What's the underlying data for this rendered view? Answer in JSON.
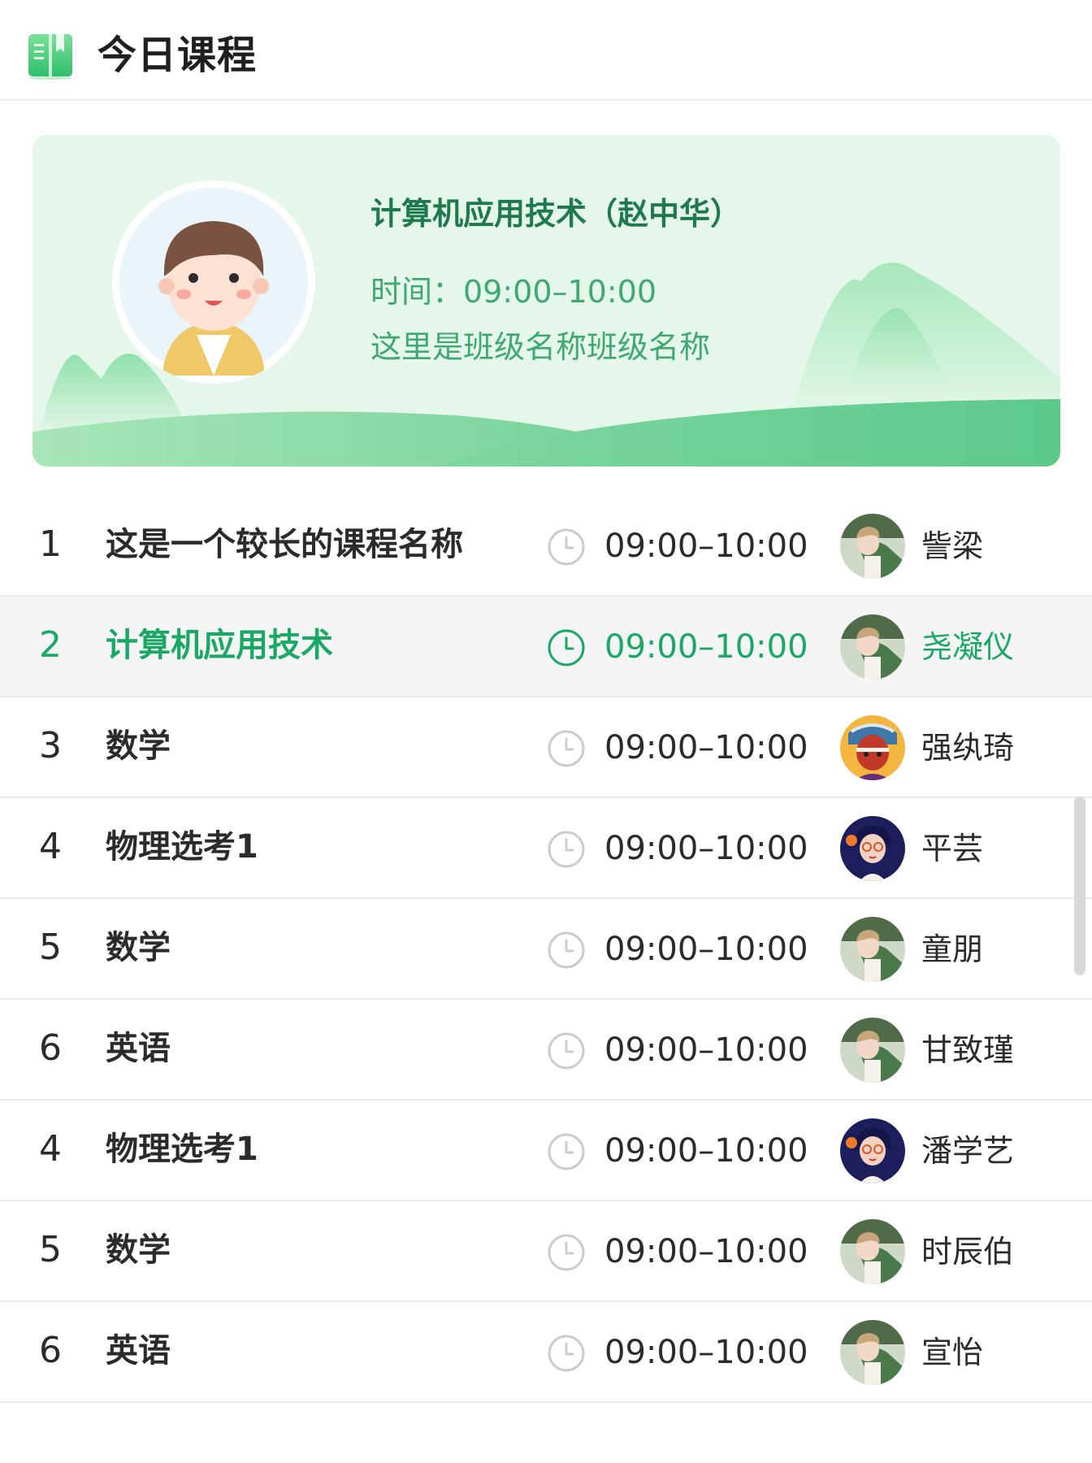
{
  "header": {
    "title": "今日课程",
    "icon": "book-icon"
  },
  "banner": {
    "course": "计算机应用技术（赵中华）",
    "time": "时间：09:00–10:00",
    "class_name": "这里是班级名称班级名称",
    "avatar": "teacher-cartoon-avatar"
  },
  "courses": [
    {
      "index": "1",
      "name": "这是一个较长的课程名称",
      "time": "09:00–10:00",
      "teacher": "訾梁",
      "avatar": "photo-boy",
      "active": false
    },
    {
      "index": "2",
      "name": "计算机应用技术",
      "time": "09:00–10:00",
      "teacher": "尧凝仪",
      "avatar": "photo-boy",
      "active": true
    },
    {
      "index": "3",
      "name": "数学",
      "time": "09:00–10:00",
      "teacher": "强纨琦",
      "avatar": "illustration-warrior",
      "active": false
    },
    {
      "index": "4",
      "name": "物理选考1",
      "time": "09:00–10:00",
      "teacher": "平芸",
      "avatar": "illustration-woman",
      "active": false
    },
    {
      "index": "5",
      "name": "数学",
      "time": "09:00–10:00",
      "teacher": "童朋",
      "avatar": "photo-boy",
      "active": false
    },
    {
      "index": "6",
      "name": "英语",
      "time": "09:00–10:00",
      "teacher": "甘致瑾",
      "avatar": "photo-boy",
      "active": false
    },
    {
      "index": "4",
      "name": "物理选考1",
      "time": "09:00–10:00",
      "teacher": "潘学艺",
      "avatar": "illustration-woman",
      "active": false
    },
    {
      "index": "5",
      "name": "数学",
      "time": "09:00–10:00",
      "teacher": "时辰伯",
      "avatar": "photo-boy",
      "active": false
    },
    {
      "index": "6",
      "name": "英语",
      "time": "09:00–10:00",
      "teacher": "宣怡",
      "avatar": "photo-boy",
      "active": false
    }
  ],
  "colors": {
    "accent": "#1aa865",
    "banner_title": "#1e7a4e",
    "banner_text": "#3fa873",
    "clock_inactive": "#cccccc"
  }
}
